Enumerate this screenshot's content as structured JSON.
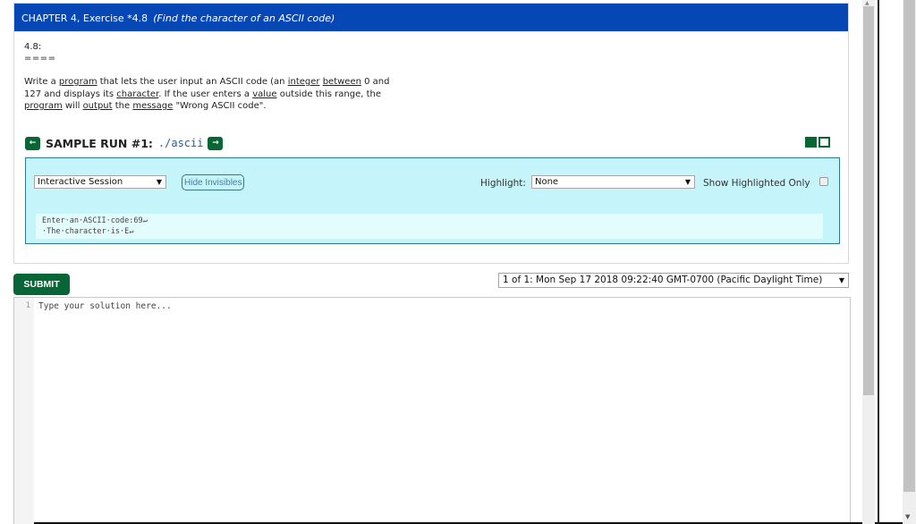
{
  "exercise": {
    "header": "CHAPTER 4, Exercise *4.8",
    "header_subtitle": "(Find the character of an ASCII code)",
    "problem_id": "4.8:",
    "problem_underline": "====",
    "description_parts": [
      {
        "text": "Write a ",
        "link": false
      },
      {
        "text": "program",
        "link": true
      },
      {
        "text": " that lets the user input an ASCII code (an ",
        "link": false
      },
      {
        "text": "integer",
        "link": true
      },
      {
        "text": " ",
        "link": false
      },
      {
        "text": "between",
        "link": true
      },
      {
        "text": " 0 and 127 and displays its ",
        "link": false
      },
      {
        "text": "character",
        "link": true
      },
      {
        "text": ". If the user enters a ",
        "link": false
      },
      {
        "text": "value",
        "link": true
      },
      {
        "text": " outside this range, the ",
        "link": false
      },
      {
        "text": "program",
        "link": true
      },
      {
        "text": " will ",
        "link": false
      },
      {
        "text": "output",
        "link": true
      },
      {
        "text": " the ",
        "link": false
      },
      {
        "text": "message",
        "link": true
      },
      {
        "text": " \"Wrong ASCII code\".",
        "link": false
      }
    ]
  },
  "sample_run": {
    "prev_icon": "arrow-left-icon",
    "prev_glyph": "←",
    "title": "SAMPLE RUN #1:",
    "command": "./ascii",
    "next_icon": "arrow-right-icon",
    "next_glyph": "→"
  },
  "session": {
    "mode_selected": "Interactive Session",
    "dropdown_glyph": "▼",
    "hide_invisibles_label": "Hide Invisibles",
    "highlight_label": "Highlight:",
    "highlight_selected": "None",
    "show_highlighted_only_label": "Show Highlighted Only",
    "show_highlighted_only_checked": false,
    "output": "Enter·an·ASCII·code:69↵\n·The·character·is·E↵"
  },
  "toolbar": {
    "submit_label": "SUBMIT",
    "submission_selected": "1 of 1: Mon Sep 17 2018 09:22:40 GMT-0700 (Pacific Daylight Time)"
  },
  "editor": {
    "line_number": "1",
    "placeholder": "Type your solution here..."
  },
  "colors": {
    "header_blue": "#0547b4",
    "accent_green": "#086535",
    "session_bg": "#c6f4fb"
  }
}
